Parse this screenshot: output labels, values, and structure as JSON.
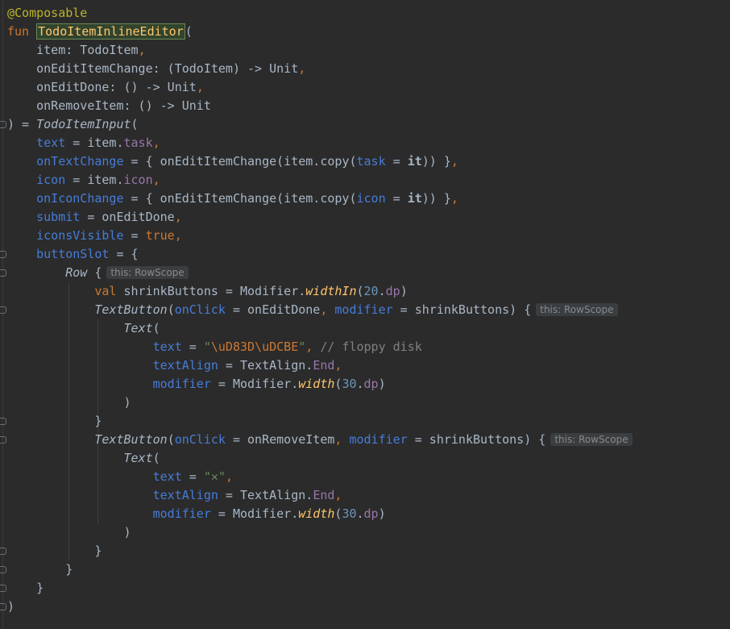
{
  "editor": {
    "lines": [
      [
        [
          "ann",
          "@Composable"
        ]
      ],
      [
        [
          "k",
          "fun "
        ],
        [
          "fnh",
          "TodoItemInlineEditor"
        ],
        [
          "p",
          "("
        ]
      ],
      [
        [
          "p",
          "    item: TodoItem"
        ],
        [
          "k",
          ","
        ]
      ],
      [
        [
          "p",
          "    onEditItemChange: (TodoItem) -> Unit"
        ],
        [
          "k",
          ","
        ]
      ],
      [
        [
          "p",
          "    onEditDone: () -> Unit"
        ],
        [
          "k",
          ","
        ]
      ],
      [
        [
          "p",
          "    onRemoveItem: () -> Unit"
        ]
      ],
      [
        [
          "p",
          ") = "
        ],
        [
          "it",
          "TodoItemInput"
        ],
        [
          "p",
          "("
        ]
      ],
      [
        [
          "prm",
          "    text"
        ],
        [
          "p",
          " = item."
        ],
        [
          "prop",
          "task"
        ],
        [
          "k",
          ","
        ]
      ],
      [
        [
          "prm",
          "    onTextChange"
        ],
        [
          "p",
          " = { onEditItemChange(item.copy("
        ],
        [
          "prm",
          "task"
        ],
        [
          "p",
          " = "
        ],
        [
          "b",
          "it"
        ],
        [
          "p",
          ")) }"
        ],
        [
          "k",
          ","
        ]
      ],
      [
        [
          "prm",
          "    icon"
        ],
        [
          "p",
          " = item."
        ],
        [
          "prop",
          "icon"
        ],
        [
          "k",
          ","
        ]
      ],
      [
        [
          "prm",
          "    onIconChange"
        ],
        [
          "p",
          " = { onEditItemChange(item.copy("
        ],
        [
          "prm",
          "icon"
        ],
        [
          "p",
          " = "
        ],
        [
          "b",
          "it"
        ],
        [
          "p",
          ")) }"
        ],
        [
          "k",
          ","
        ]
      ],
      [
        [
          "prm",
          "    submit"
        ],
        [
          "p",
          " = onEditDone"
        ],
        [
          "k",
          ","
        ]
      ],
      [
        [
          "prm",
          "    iconsVisible"
        ],
        [
          "p",
          " = "
        ],
        [
          "k",
          "true,"
        ]
      ],
      [
        [
          "prm",
          "    buttonSlot"
        ],
        [
          "p",
          " = {"
        ]
      ],
      [
        [
          "p",
          "        "
        ],
        [
          "it",
          "Row"
        ],
        [
          "p",
          " {"
        ],
        [
          "hint",
          "this: RowScope"
        ]
      ],
      [
        [
          "k",
          "            val "
        ],
        [
          "p",
          "shrinkButtons = Modifier."
        ],
        [
          "ext",
          "widthIn"
        ],
        [
          "p",
          "("
        ],
        [
          "n",
          "20"
        ],
        [
          "p",
          "."
        ],
        [
          "prop",
          "dp"
        ],
        [
          "p",
          ")"
        ]
      ],
      [
        [
          "p",
          "            "
        ],
        [
          "it",
          "TextButton"
        ],
        [
          "p",
          "("
        ],
        [
          "prm",
          "onClick"
        ],
        [
          "p",
          " = onEditDone"
        ],
        [
          "k",
          ", "
        ],
        [
          "prm",
          "modifier"
        ],
        [
          "p",
          " = shrinkButtons) {"
        ],
        [
          "hint",
          "this: RowScope"
        ]
      ],
      [
        [
          "p",
          "                "
        ],
        [
          "it",
          "Text"
        ],
        [
          "p",
          "("
        ]
      ],
      [
        [
          "prm",
          "                    text"
        ],
        [
          "p",
          " = "
        ],
        [
          "s",
          "\""
        ],
        [
          "esc",
          "\\uD83D\\uDCBE"
        ],
        [
          "s",
          "\""
        ],
        [
          "k",
          ", "
        ],
        [
          "c",
          "// floppy disk"
        ]
      ],
      [
        [
          "prm",
          "                    textAlign"
        ],
        [
          "p",
          " = TextAlign."
        ],
        [
          "prop",
          "End"
        ],
        [
          "k",
          ","
        ]
      ],
      [
        [
          "prm",
          "                    modifier"
        ],
        [
          "p",
          " = Modifier."
        ],
        [
          "ext",
          "width"
        ],
        [
          "p",
          "("
        ],
        [
          "n",
          "30"
        ],
        [
          "p",
          "."
        ],
        [
          "prop",
          "dp"
        ],
        [
          "p",
          ")"
        ]
      ],
      [
        [
          "p",
          "                )"
        ]
      ],
      [
        [
          "p",
          "            }"
        ]
      ],
      [
        [
          "p",
          "            "
        ],
        [
          "it",
          "TextButton"
        ],
        [
          "p",
          "("
        ],
        [
          "prm",
          "onClick"
        ],
        [
          "p",
          " = onRemoveItem"
        ],
        [
          "k",
          ", "
        ],
        [
          "prm",
          "modifier"
        ],
        [
          "p",
          " = shrinkButtons) {"
        ],
        [
          "hint",
          "this: RowScope"
        ]
      ],
      [
        [
          "p",
          "                "
        ],
        [
          "it",
          "Text"
        ],
        [
          "p",
          "("
        ]
      ],
      [
        [
          "prm",
          "                    text"
        ],
        [
          "p",
          " = "
        ],
        [
          "s",
          "\"✕\""
        ],
        [
          "k",
          ","
        ]
      ],
      [
        [
          "prm",
          "                    textAlign"
        ],
        [
          "p",
          " = TextAlign."
        ],
        [
          "prop",
          "End"
        ],
        [
          "k",
          ","
        ]
      ],
      [
        [
          "prm",
          "                    modifier"
        ],
        [
          "p",
          " = Modifier."
        ],
        [
          "ext",
          "width"
        ],
        [
          "p",
          "("
        ],
        [
          "n",
          "30"
        ],
        [
          "p",
          "."
        ],
        [
          "prop",
          "dp"
        ],
        [
          "p",
          ")"
        ]
      ],
      [
        [
          "p",
          "                )"
        ]
      ],
      [
        [
          "p",
          "            }"
        ]
      ],
      [
        [
          "p",
          "        }"
        ]
      ],
      [
        [
          "p",
          "    }"
        ]
      ],
      [
        [
          "p",
          ")"
        ]
      ]
    ]
  }
}
